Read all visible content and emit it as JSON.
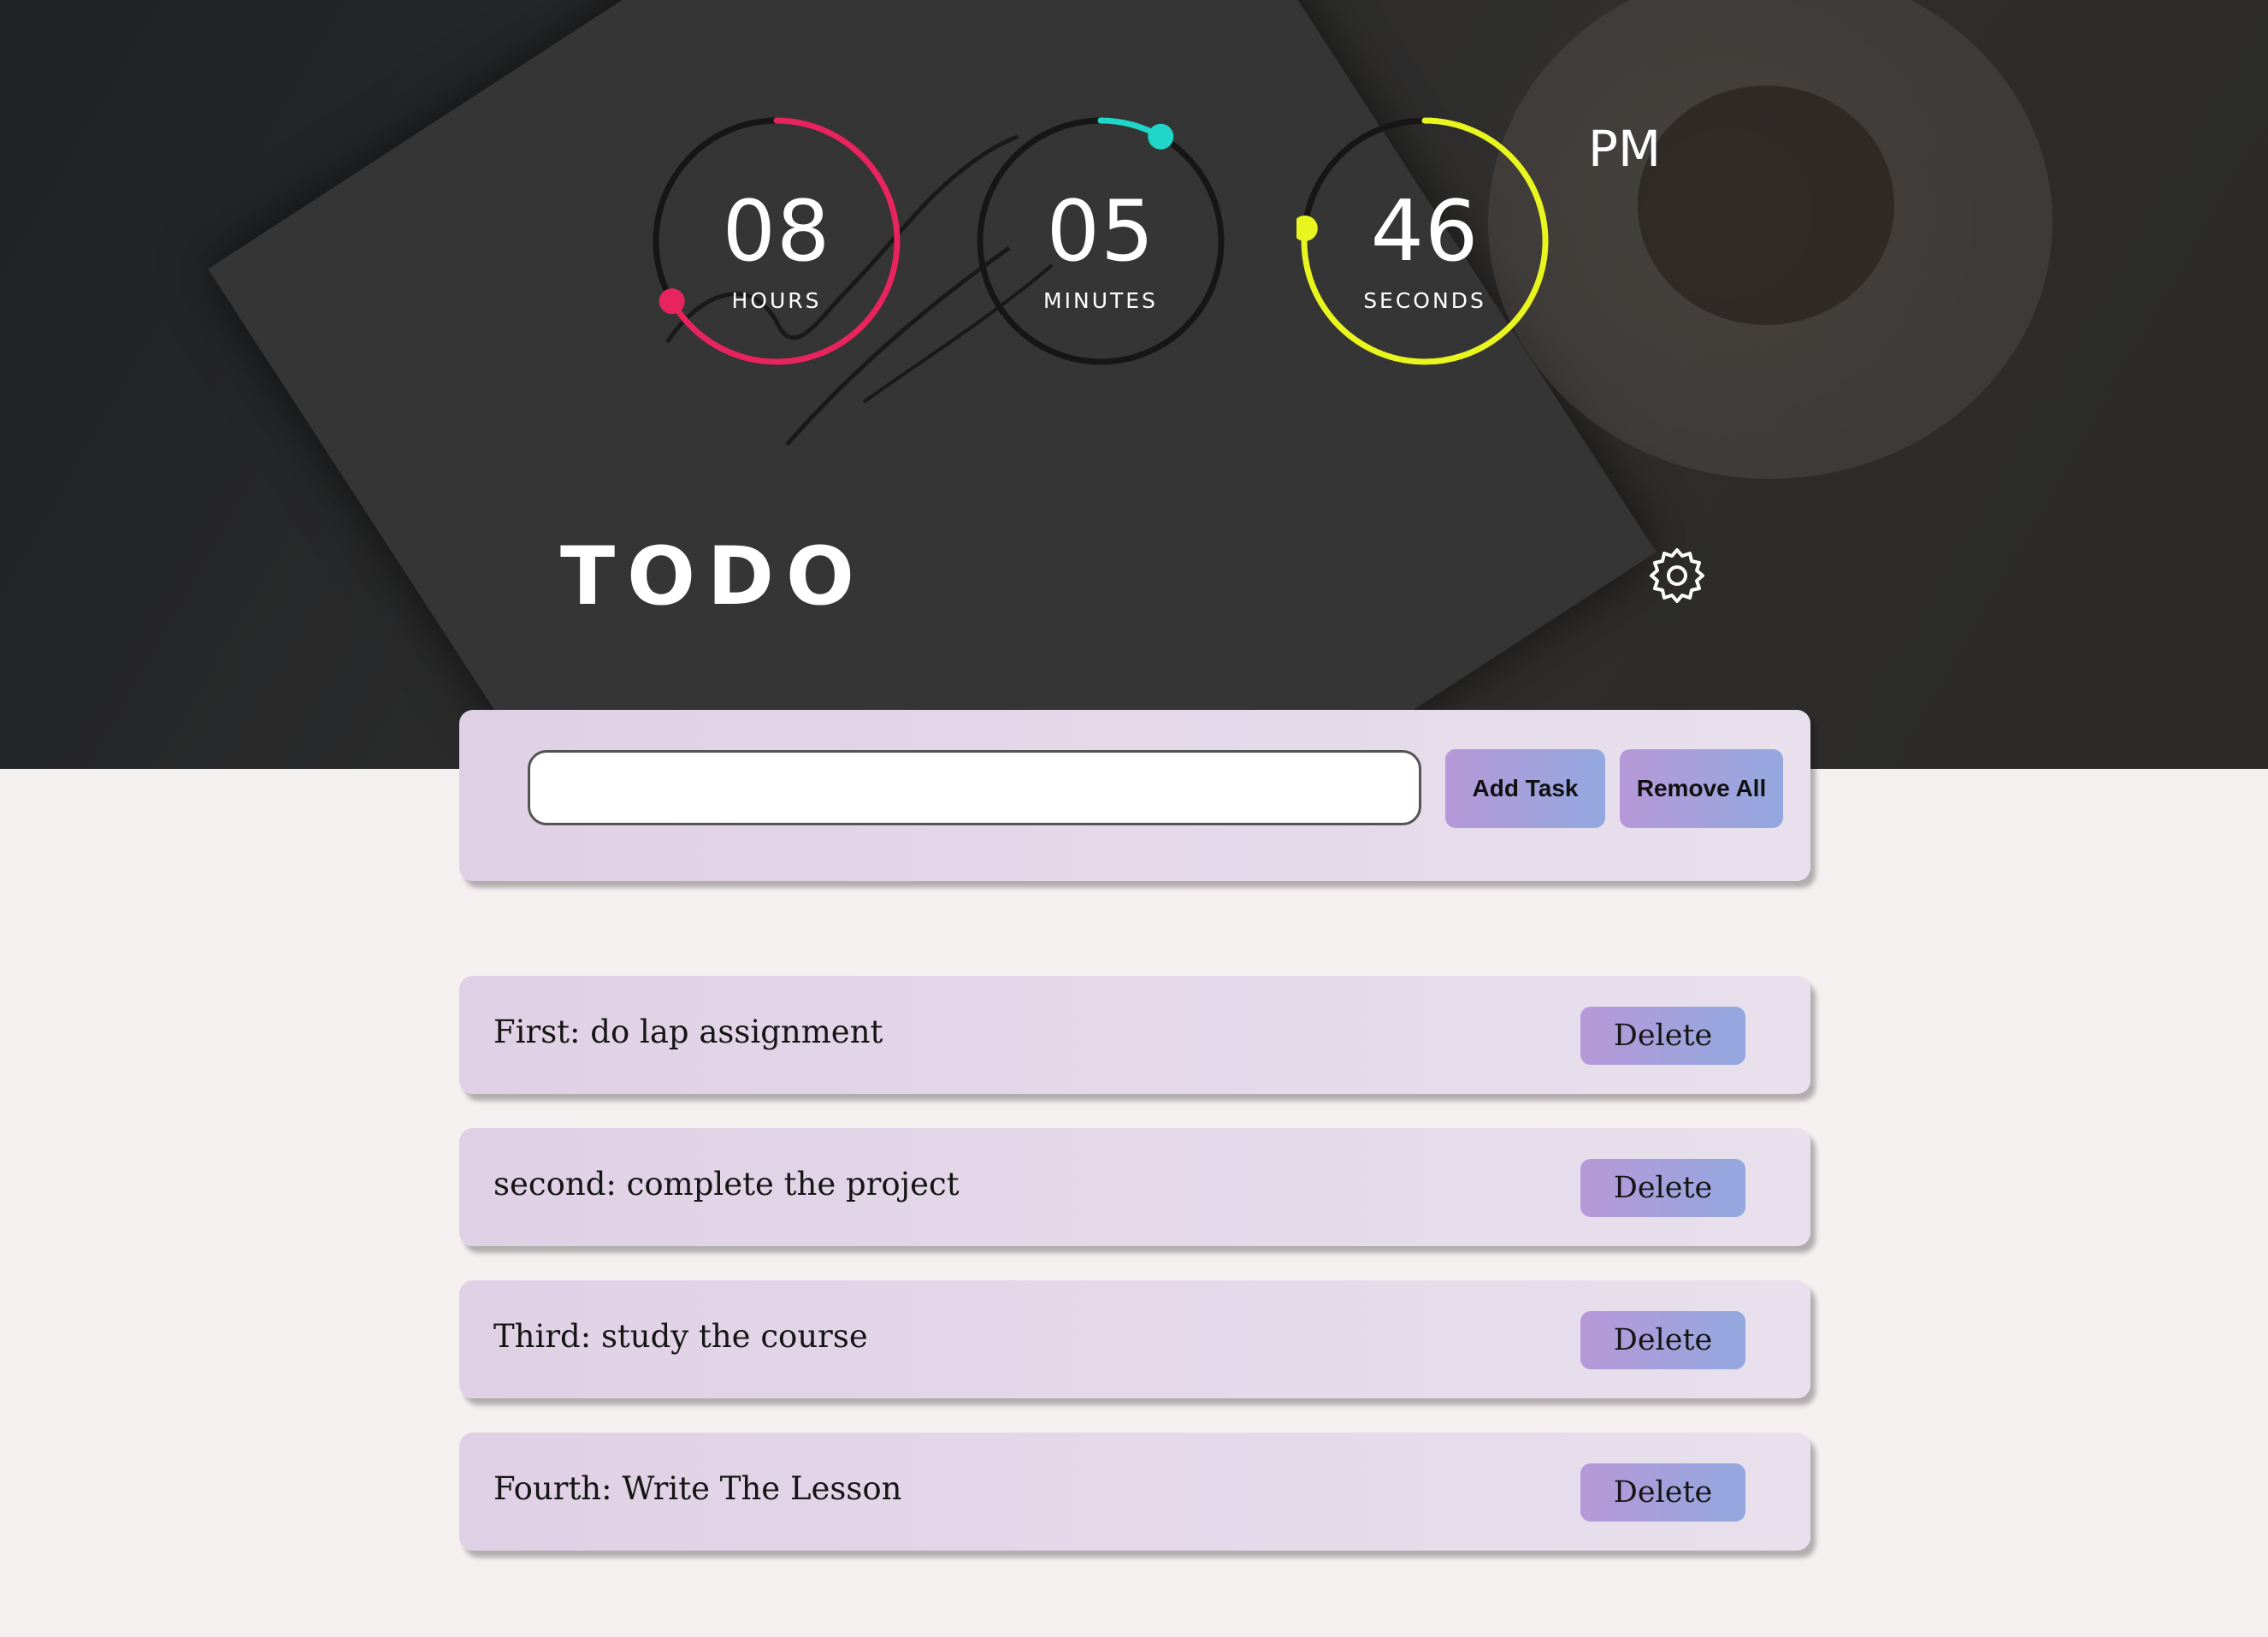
{
  "clock": {
    "hours": {
      "value": "08",
      "label": "HOURS",
      "progress": 0.667,
      "color": "#e8245e"
    },
    "minutes": {
      "value": "05",
      "label": "MINUTES",
      "progress": 0.083,
      "color": "#1fd6c8"
    },
    "seconds": {
      "value": "46",
      "label": "SECONDS",
      "progress": 0.767,
      "color": "#e8f51e"
    },
    "period": "PM"
  },
  "app": {
    "title": "TODO",
    "settings_icon": "gear-icon"
  },
  "input": {
    "value": "",
    "placeholder": ""
  },
  "buttons": {
    "add": "Add Task",
    "remove_all": "Remove All"
  },
  "tasks": [
    {
      "text": "First: do lap assignment",
      "delete_label": "Delete"
    },
    {
      "text": "second: complete the project",
      "delete_label": "Delete"
    },
    {
      "text": "Third: study the course",
      "delete_label": "Delete"
    },
    {
      "text": "Fourth: Write The Lesson",
      "delete_label": "Delete"
    }
  ]
}
